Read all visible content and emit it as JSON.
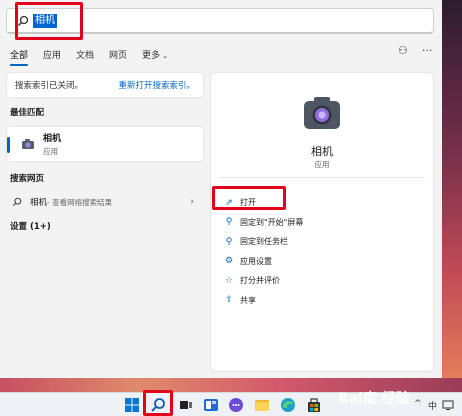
{
  "search": {
    "query": "相机"
  },
  "tabs": [
    {
      "label": "全部",
      "active": true
    },
    {
      "label": "应用"
    },
    {
      "label": "文档"
    },
    {
      "label": "网页"
    },
    {
      "label": "更多"
    }
  ],
  "index_bar": {
    "message": "搜索索引已关闭。",
    "link": "重新打开搜索索引。"
  },
  "best_match": {
    "heading": "最佳匹配",
    "name": "相机",
    "type": "应用"
  },
  "web_search": {
    "heading": "搜索网页",
    "label": "相机",
    "suffix": " - 查看网络搜索结果"
  },
  "settings": {
    "heading": "设置 (1+)"
  },
  "detail": {
    "name": "相机",
    "type": "应用",
    "actions": [
      {
        "label": "打开",
        "icon": "open-external-icon"
      },
      {
        "label": "固定到\"开始\"屏幕",
        "icon": "pin-icon"
      },
      {
        "label": "固定到任务栏",
        "icon": "pin-taskbar-icon"
      },
      {
        "label": "应用设置",
        "icon": "gear-icon"
      },
      {
        "label": "打分并评价",
        "icon": "star-icon"
      },
      {
        "label": "共享",
        "icon": "share-icon"
      }
    ]
  },
  "taskbar": {
    "ime": "中",
    "tray_arrow": "^"
  },
  "colors": {
    "accent": "#0067c0",
    "highlight": "#e3001b"
  }
}
